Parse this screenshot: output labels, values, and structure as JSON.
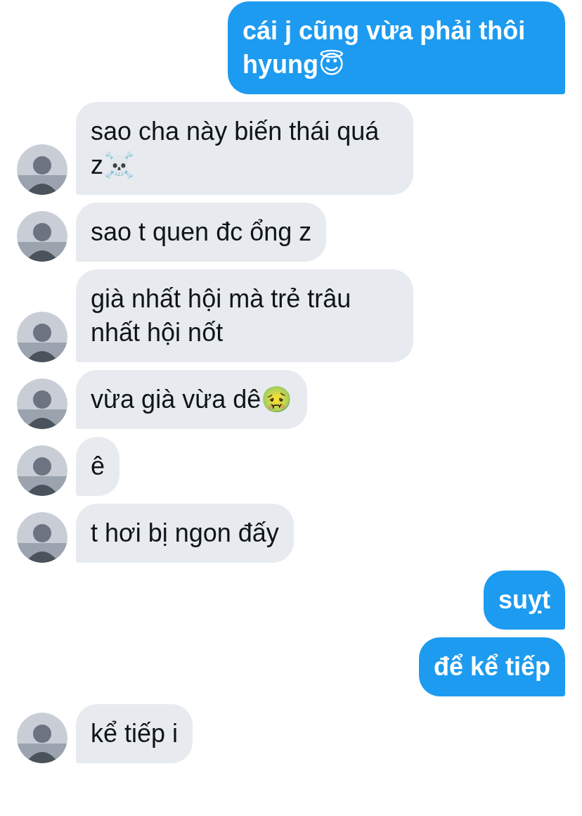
{
  "messages": [
    {
      "outgoing": true,
      "text": "cái j cũng vừa phải thôi hyung😇"
    },
    {
      "outgoing": false,
      "text": "sao cha này biến thái quá z☠️"
    },
    {
      "outgoing": false,
      "text": "sao t quen đc ổng z"
    },
    {
      "outgoing": false,
      "text": "già nhất hội mà trẻ trâu nhất hội nốt"
    },
    {
      "outgoing": false,
      "text": "vừa già vừa dê🤢"
    },
    {
      "outgoing": false,
      "text": "ê"
    },
    {
      "outgoing": false,
      "text": "t hơi bị ngon đấy"
    },
    {
      "outgoing": true,
      "text": "suỵt"
    },
    {
      "outgoing": true,
      "text": "để kể tiếp"
    },
    {
      "outgoing": false,
      "text": "kể tiếp i"
    }
  ]
}
